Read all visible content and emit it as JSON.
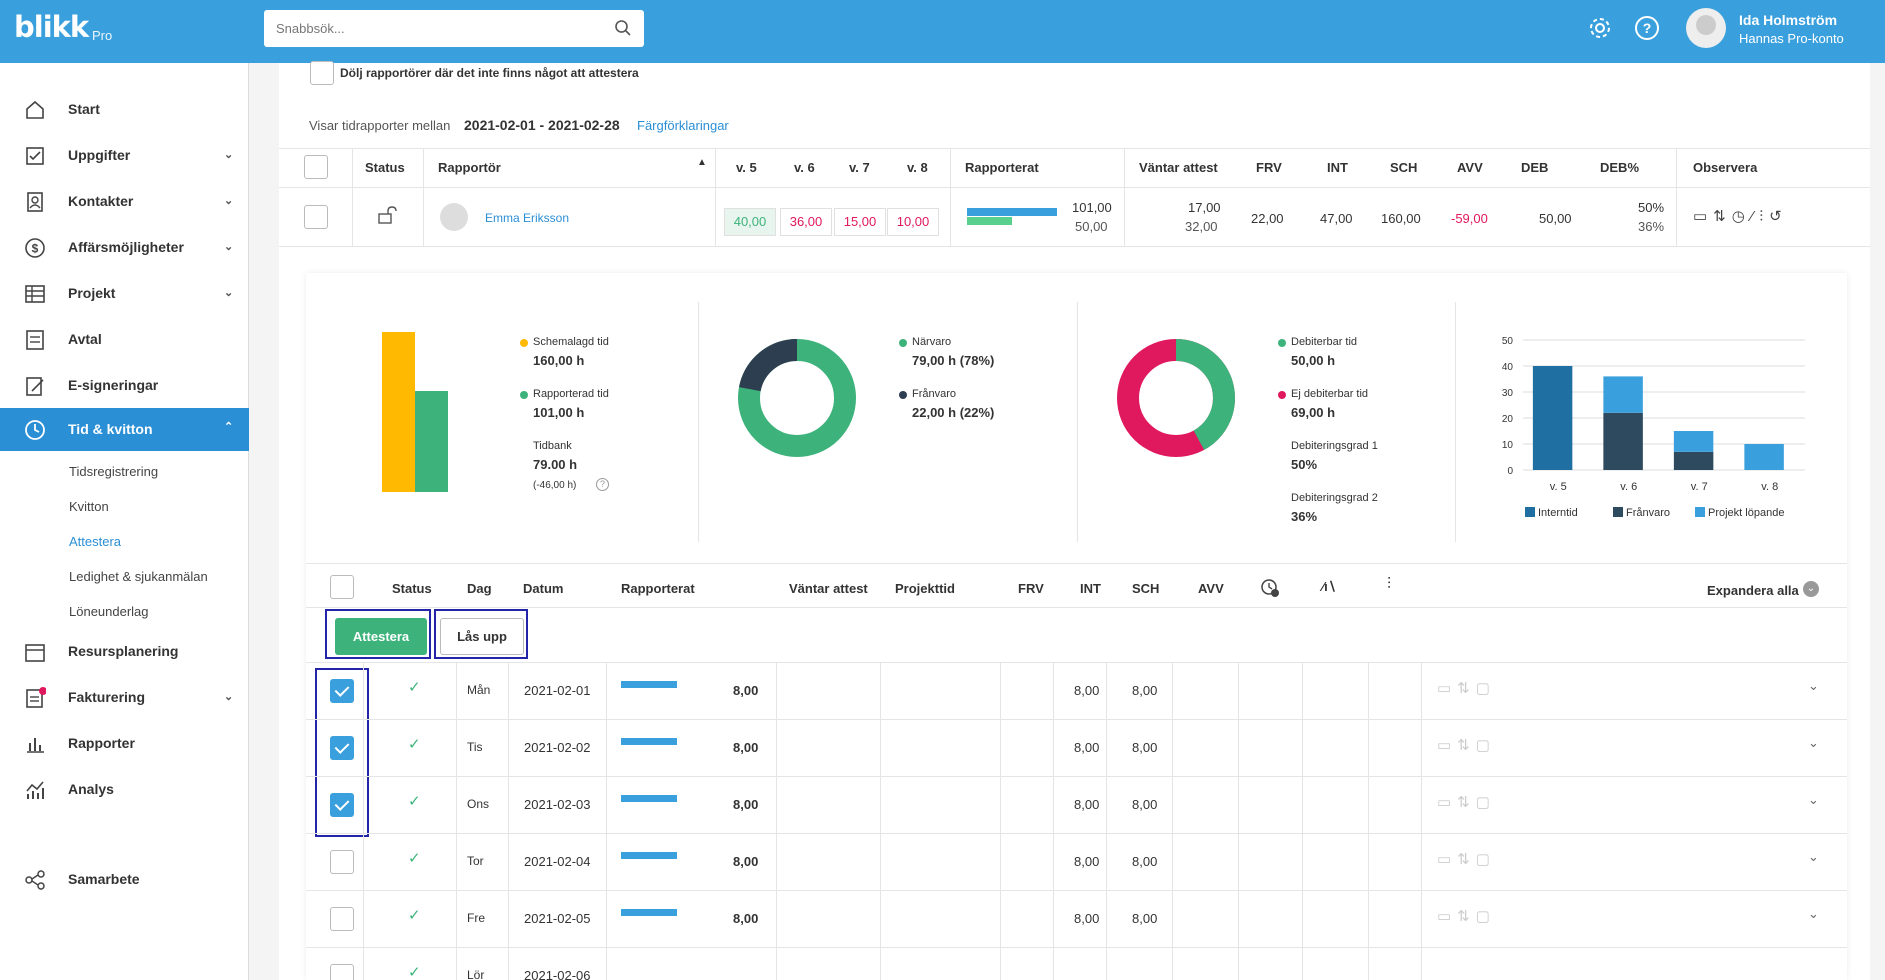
{
  "topbar": {
    "logo": "blikk",
    "logo_suffix": "Pro",
    "search_placeholder": "Snabbsök...",
    "user_name": "Ida Holmström",
    "user_account": "Hannas Pro-konto"
  },
  "sidebar": {
    "items": [
      {
        "label": "Start",
        "icon": "home-icon"
      },
      {
        "label": "Uppgifter",
        "icon": "checkbox-icon"
      },
      {
        "label": "Kontakter",
        "icon": "contacts-icon"
      },
      {
        "label": "Affärsmöjligheter",
        "icon": "dollar-icon"
      },
      {
        "label": "Projekt",
        "icon": "table-icon"
      },
      {
        "label": "Avtal",
        "icon": "document-icon"
      },
      {
        "label": "E-signeringar",
        "icon": "signature-icon"
      },
      {
        "label": "Tid & kvitton",
        "icon": "clock-icon"
      },
      {
        "label": "Resursplanering",
        "icon": "calendar-icon"
      },
      {
        "label": "Fakturering",
        "icon": "invoice-icon"
      },
      {
        "label": "Rapporter",
        "icon": "bar-chart-icon"
      },
      {
        "label": "Analys",
        "icon": "analytics-icon"
      },
      {
        "label": "Samarbete",
        "icon": "share-icon"
      }
    ],
    "sub_items": [
      "Tidsregistrering",
      "Kvitton",
      "Attestera",
      "Ledighet & sjukanmälan",
      "Löneunderlag"
    ]
  },
  "filter": {
    "hide_label": "Dölj rapportörer där det inte finns något att attestera",
    "range_prefix": "Visar tidrapporter mellan",
    "range": "2021-02-01 - 2021-02-28",
    "legend_link": "Färgförklaringar"
  },
  "table": {
    "headers": {
      "status": "Status",
      "reporter": "Rapportör",
      "w5": "v. 5",
      "w6": "v. 6",
      "w7": "v. 7",
      "w8": "v. 8",
      "reported": "Rapporterat",
      "waiting": "Väntar attest",
      "frv": "FRV",
      "int": "INT",
      "sch": "SCH",
      "avv": "AVV",
      "deb": "DEB",
      "debp": "DEB%",
      "observe": "Observera"
    },
    "row": {
      "name": "Emma Eriksson",
      "w5": "40,00",
      "w6": "36,00",
      "w7": "15,00",
      "w8": "10,00",
      "reported_top": "101,00",
      "reported_bottom": "50,00",
      "waiting_top": "17,00",
      "waiting_bottom": "32,00",
      "frv": "22,00",
      "int": "47,00",
      "sch": "160,00",
      "avv": "-59,00",
      "deb": "50,00",
      "debp_top": "50%",
      "debp_bottom": "36%"
    }
  },
  "summary": {
    "bar": {
      "scheduled_label": "Schemalagd tid",
      "scheduled_value": "160,00 h",
      "reported_label": "Rapporterad tid",
      "reported_value": "101,00 h",
      "timebank_label": "Tidbank",
      "timebank_value": "79.00 h",
      "timebank_sub": "(-46,00 h)"
    },
    "donut1": {
      "present_label": "Närvaro",
      "present_value": "79,00 h (78%)",
      "absent_label": "Frånvaro",
      "absent_value": "22,00 h (22%)"
    },
    "donut2": {
      "billable_label": "Debiterbar tid",
      "billable_value": "50,00 h",
      "nonbillable_label": "Ej debiterbar tid",
      "nonbillable_value": "69,00 h",
      "rate1_label": "Debiteringsgrad 1",
      "rate1_value": "50%",
      "rate2_label": "Debiteringsgrad 2",
      "rate2_value": "36%"
    }
  },
  "chart_data": {
    "type": "bar",
    "stacked": true,
    "categories": [
      "v. 5",
      "v. 6",
      "v. 7",
      "v. 8"
    ],
    "ylim": [
      0,
      50
    ],
    "yticks": [
      "50",
      "40",
      "30",
      "20",
      "10",
      "0"
    ],
    "series": [
      {
        "name": "Interntid",
        "color": "#1f6fa3",
        "values": [
          40,
          0,
          0,
          0
        ]
      },
      {
        "name": "Frånvaro",
        "color": "#2d4a5e",
        "values": [
          0,
          22,
          7,
          0
        ]
      },
      {
        "name": "Projekt löpande",
        "color": "#3aa0dd",
        "values": [
          0,
          14,
          8,
          10
        ]
      }
    ]
  },
  "detail": {
    "headers": {
      "status": "Status",
      "day": "Dag",
      "date": "Datum",
      "reported": "Rapporterat",
      "waiting": "Väntar attest",
      "project": "Projekttid",
      "frv": "FRV",
      "int": "INT",
      "sch": "SCH",
      "avv": "AVV"
    },
    "expand_all": "Expandera alla",
    "approve_button": "Attestera",
    "unlock_button": "Lås upp",
    "rows": [
      {
        "day": "Mån",
        "date": "2021-02-01",
        "reported": "8,00",
        "int": "8,00",
        "sch": "8,00",
        "checked": true
      },
      {
        "day": "Tis",
        "date": "2021-02-02",
        "reported": "8,00",
        "int": "8,00",
        "sch": "8,00",
        "checked": true
      },
      {
        "day": "Ons",
        "date": "2021-02-03",
        "reported": "8,00",
        "int": "8,00",
        "sch": "8,00",
        "checked": true
      },
      {
        "day": "Tor",
        "date": "2021-02-04",
        "reported": "8,00",
        "int": "8,00",
        "sch": "8,00",
        "checked": false
      },
      {
        "day": "Fre",
        "date": "2021-02-05",
        "reported": "8,00",
        "int": "8,00",
        "sch": "8,00",
        "checked": false
      },
      {
        "day": "Lör",
        "date": "2021-02-06",
        "reported": "",
        "int": "",
        "sch": "",
        "checked": false
      }
    ]
  },
  "colors": {
    "brand": "#3aa0dd",
    "green": "#3db37b",
    "red": "#e0185e",
    "dark": "#2d3e50",
    "yellow": "#ffb900"
  }
}
